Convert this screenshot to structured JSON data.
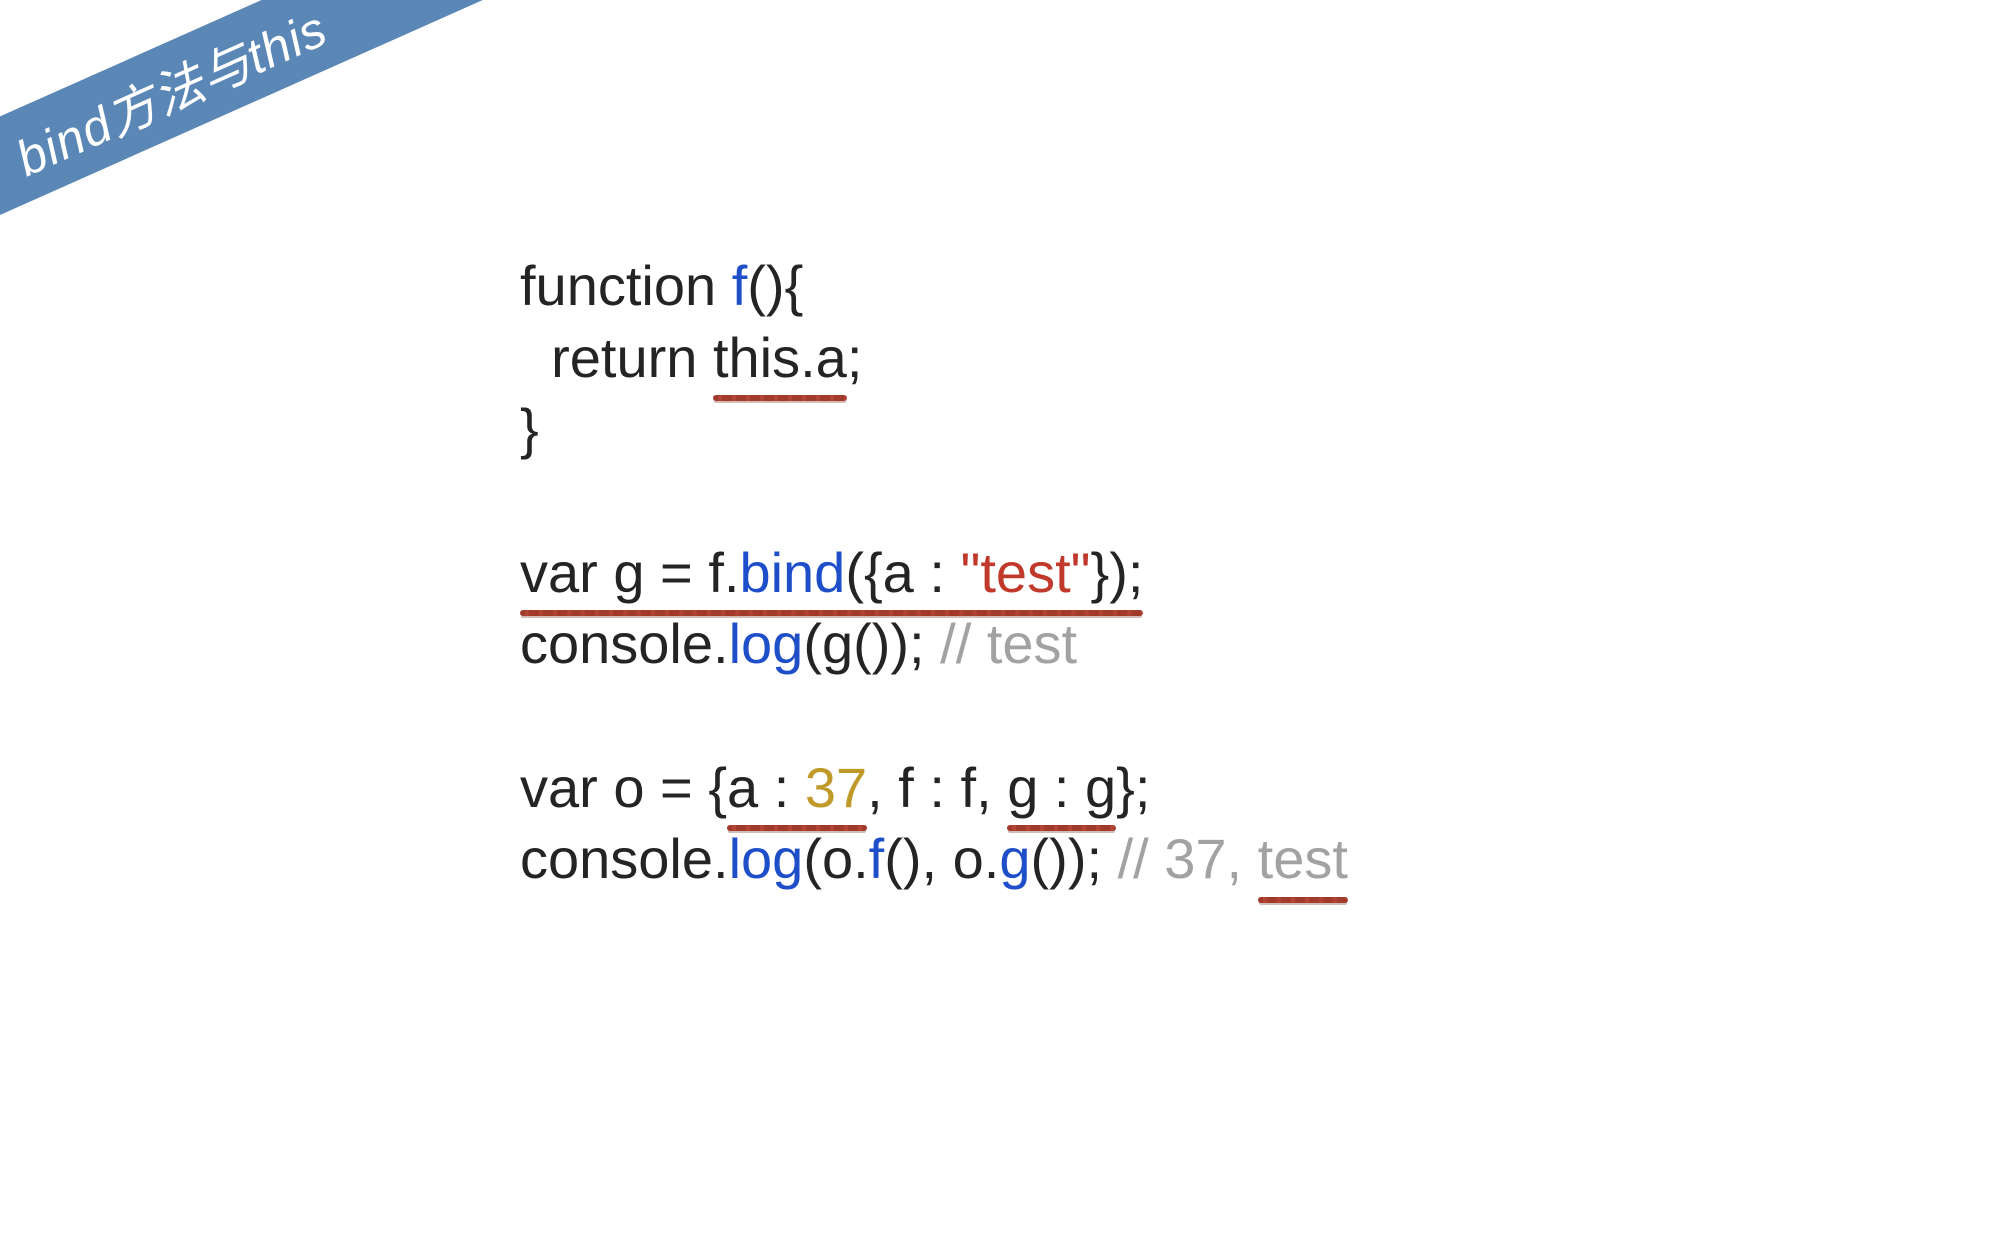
{
  "ribbon": {
    "title": "bind方法与this"
  },
  "code": {
    "l1_kw": "function ",
    "l1_fn": "f",
    "l1_tail": "(){",
    "l2_a": "  return ",
    "l2_b": "this.a",
    "l2_c": ";",
    "l3": "}",
    "l5_a": "var g = f.",
    "l5_bind": "bind",
    "l5_b": "({a : ",
    "l5_str": "\"test\"",
    "l5_c": "});",
    "l6_a": "console.",
    "l6_log": "log",
    "l6_b": "(g()); ",
    "l6_cmt": "// test",
    "l8_a": "var o = {",
    "l8_b": "a : ",
    "l8_num": "37",
    "l8_c": ", f : f, ",
    "l8_d": "g : g",
    "l8_e": "};",
    "l9_a": "console.",
    "l9_log": "log",
    "l9_b": "(o.",
    "l9_f": "f",
    "l9_c": "(), o.",
    "l9_g": "g",
    "l9_d": "()); ",
    "l9_cmt1": "// 37, ",
    "l9_cmt2": "test"
  }
}
